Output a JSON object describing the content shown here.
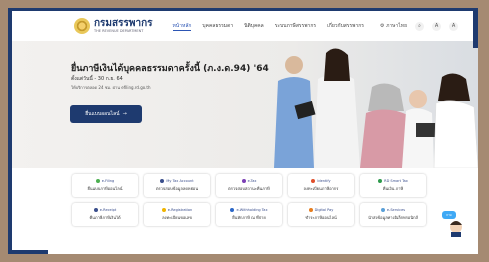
{
  "brand": {
    "name": "กรมสรรพากร",
    "sub": "THE REVENUE DEPARTMENT"
  },
  "menu": [
    {
      "label": "หน้าหลัก",
      "active": true
    },
    {
      "label": "บุคคลธรรมดา"
    },
    {
      "label": "นิติบุคคล"
    },
    {
      "label": "ระบบภาษีสรรพากร"
    },
    {
      "label": "เกี่ยวกับสรรพากร"
    }
  ],
  "tools": {
    "lang": "ภาษาไทย",
    "font_small": "A",
    "font_big": "A"
  },
  "hero": {
    "title": "ยื่นภาษีเงินได้บุคคลธรรมดาครั้งนี้ (ภ.ง.ด.94) '64",
    "date": "ตั้งแต่วันนี้ - 30 ก.ย. 64",
    "time": "ให้บริการตลอด 24 ชม. ผ่าน efiling.rd.go.th",
    "button": "ยื่นแบบออนไลน์"
  },
  "cards": [
    {
      "brand": "e-Filing",
      "label": "ยื่นแบบภาษีออนไลน์",
      "color": "#4caf50"
    },
    {
      "brand": "My Tax Account",
      "label": "ตรวจสอบข้อมูลลดหย่อน",
      "color": "#3a4e8c"
    },
    {
      "brand": "e-Tax",
      "label": "ตรวจสอบสถานะคืนภาษี",
      "color": "#7b3fb5"
    },
    {
      "brand": "Identify",
      "label": "ลงทะเบียนภาษีอากร",
      "color": "#e04f2c"
    },
    {
      "brand": "RD Smart Tax",
      "label": "คืนเงิน ภาษี",
      "color": "#2e9a4c"
    },
    {
      "brand": "e-Receipt",
      "label": "คืนภาษีภาษีเงินได้",
      "color": "#3a4e8c"
    },
    {
      "brand": "e-Registration",
      "label": "ลงทะเบียนขอเลข",
      "color": "#f0b400"
    },
    {
      "brand": "e-Withholding Tax",
      "label": "ยื่นหักภาษี ณ ที่จ่าย",
      "color": "#2b67c7"
    },
    {
      "brand": "Digital Pay",
      "label": "ชำระภาษีออนไลน์",
      "color": "#e67d1e"
    },
    {
      "brand": "e-Services",
      "label": "นำส่งข้อมูลทางอิเล็กทรอนิกส์",
      "color": "#5aa0d8"
    }
  ],
  "chat": {
    "label": "ถาม"
  }
}
